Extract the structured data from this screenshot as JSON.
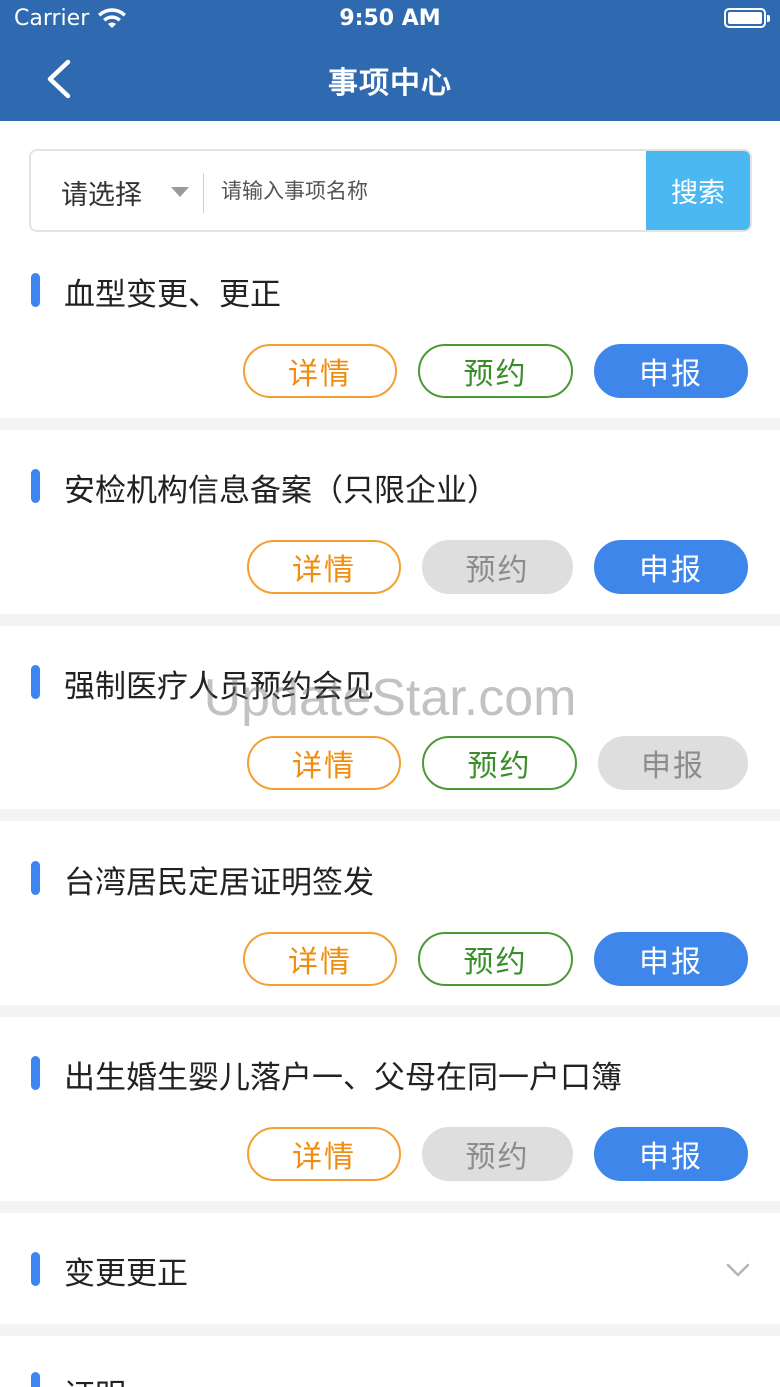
{
  "status_bar": {
    "carrier": "Carrier",
    "time": "9:50 AM"
  },
  "nav": {
    "title": "事项中心"
  },
  "search": {
    "select_label": "请选择",
    "placeholder": "请输入事项名称",
    "button_label": "搜索"
  },
  "labels": {
    "detail": "详情",
    "book": "预约",
    "report": "申报"
  },
  "items": [
    {
      "title": "血型变更、更正",
      "book_enabled": true,
      "report_enabled": true
    },
    {
      "title": "安检机构信息备案（只限企业）",
      "book_enabled": false,
      "report_enabled": true
    },
    {
      "title": "强制医疗人员预约会见",
      "book_enabled": true,
      "report_enabled": false
    },
    {
      "title": "台湾居民定居证明签发",
      "book_enabled": true,
      "report_enabled": true
    },
    {
      "title": "出生婚生婴儿落户一、父母在同一户口簿",
      "book_enabled": false,
      "report_enabled": true
    }
  ],
  "categories": [
    {
      "title": "变更更正"
    },
    {
      "title": "证明"
    }
  ],
  "watermark": "UpdateStar.com",
  "colors": {
    "nav_bg": "#2f6ab0",
    "search_button": "#4bb8f2",
    "accent_bar": "#3d86f0",
    "detail": "#f08d10",
    "book": "#3a8e2a",
    "report": "#3f86ea",
    "disabled": "#dedede"
  }
}
